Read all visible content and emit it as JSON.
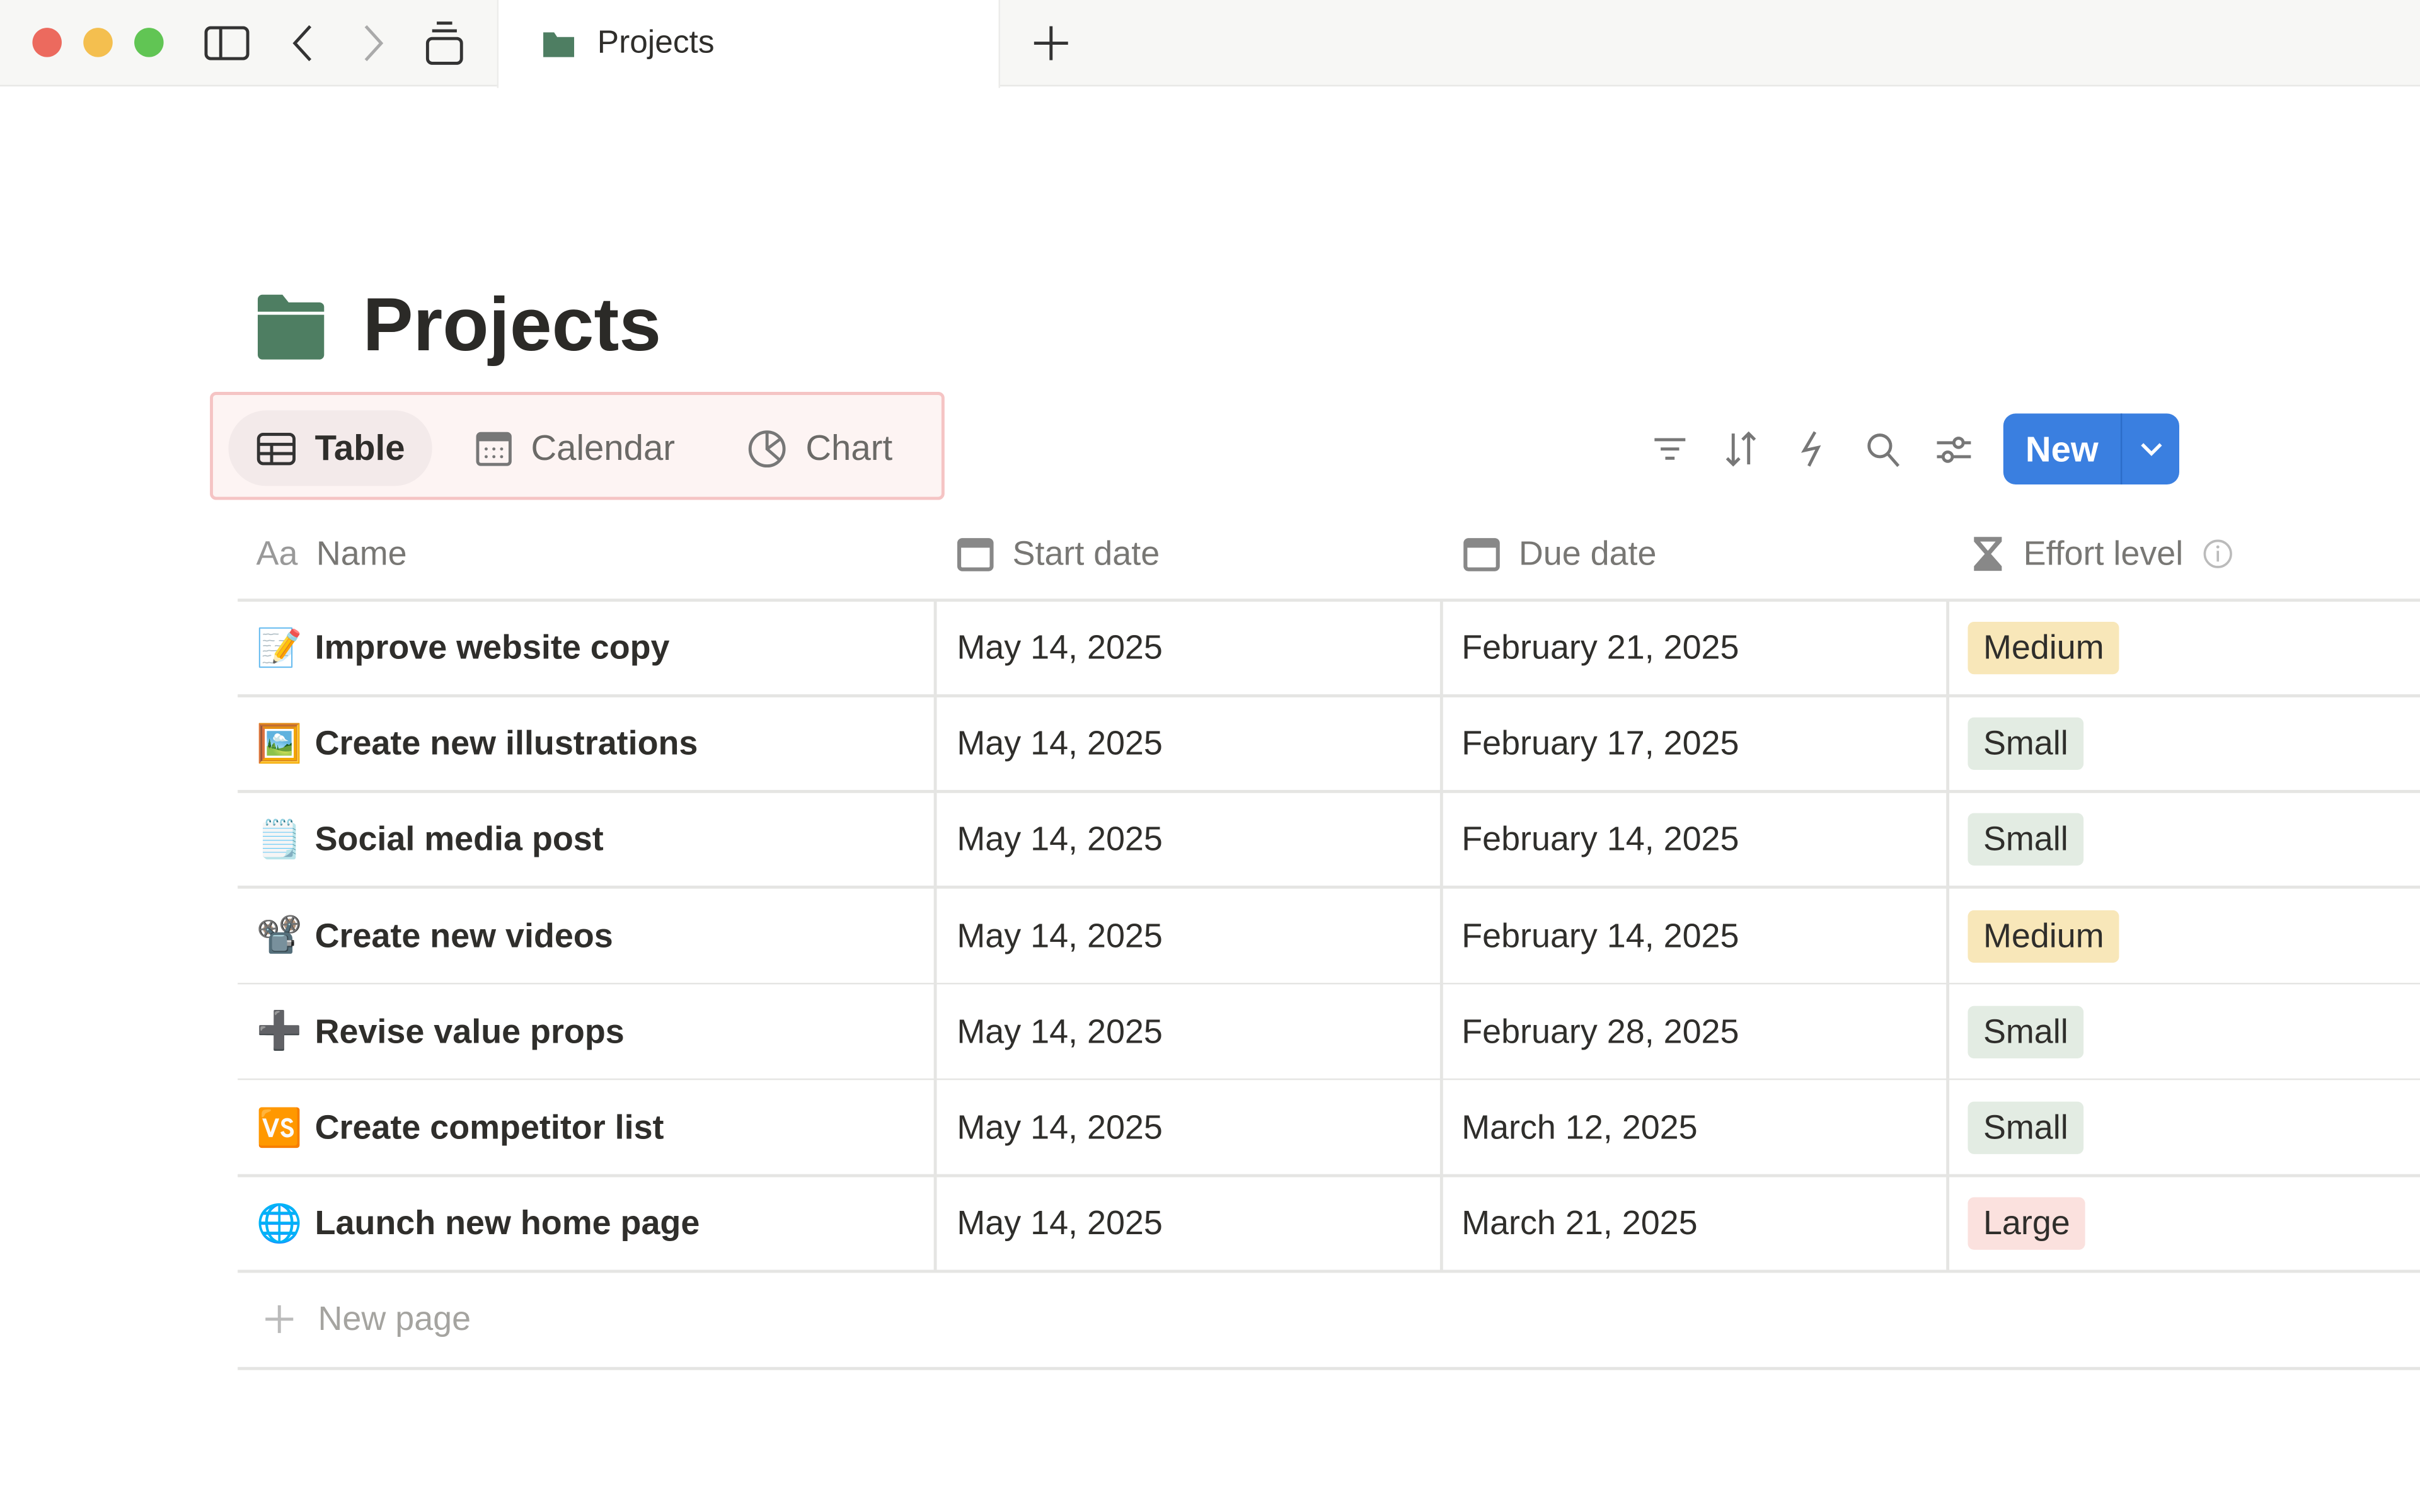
{
  "browser": {
    "tab_title": "Projects",
    "icons": [
      "sidebar-icon",
      "back-icon",
      "forward-icon",
      "tabs-icon",
      "plus-icon"
    ]
  },
  "page": {
    "title": "Projects",
    "icon": "folder-icon",
    "icon_color": "#4e7e62"
  },
  "views": [
    {
      "label": "Table",
      "icon": "table-icon",
      "active": true
    },
    {
      "label": "Calendar",
      "icon": "calendar-icon"
    },
    {
      "label": "Chart",
      "icon": "pie-chart-icon"
    }
  ],
  "toolbar": {
    "icons": [
      "filter-icon",
      "sort-icon",
      "automation-icon",
      "search-icon",
      "settings-icon"
    ],
    "new_label": "New",
    "accent": "#3a7fe0"
  },
  "columns": [
    {
      "label": "Name",
      "icon": "text-icon"
    },
    {
      "label": "Start date",
      "icon": "calendar-icon"
    },
    {
      "label": "Due date",
      "icon": "calendar-icon"
    },
    {
      "label": "Effort level",
      "icon": "hourglass-icon"
    }
  ],
  "rows": [
    {
      "emoji": "📝",
      "name": "Improve website copy",
      "start": "May 14, 2025",
      "due": "February 21, 2025",
      "effort": "Medium"
    },
    {
      "emoji": "🖼️",
      "name": "Create new illustrations",
      "start": "May 14, 2025",
      "due": "February 17, 2025",
      "effort": "Small"
    },
    {
      "emoji": "🗒️",
      "name": "Social media post",
      "start": "May 14, 2025",
      "due": "February 14, 2025",
      "effort": "Small"
    },
    {
      "emoji": "📽️",
      "name": "Create new videos",
      "start": "May 14, 2025",
      "due": "February 14, 2025",
      "effort": "Medium"
    },
    {
      "emoji": "➕",
      "name": "Revise value props",
      "start": "May 14, 2025",
      "due": "February 28, 2025",
      "effort": "Small"
    },
    {
      "emoji": "🆚",
      "name": "Create competitor list",
      "start": "May 14, 2025",
      "due": "March 12, 2025",
      "effort": "Small"
    },
    {
      "emoji": "🌐",
      "name": "Launch new home page",
      "start": "May 14, 2025",
      "due": "March 21, 2025",
      "effort": "Large"
    }
  ],
  "effort_colors": {
    "Small": "#e3ece3",
    "Medium": "#f8e7b9",
    "Large": "#fbe1de"
  },
  "new_page_label": "New page"
}
